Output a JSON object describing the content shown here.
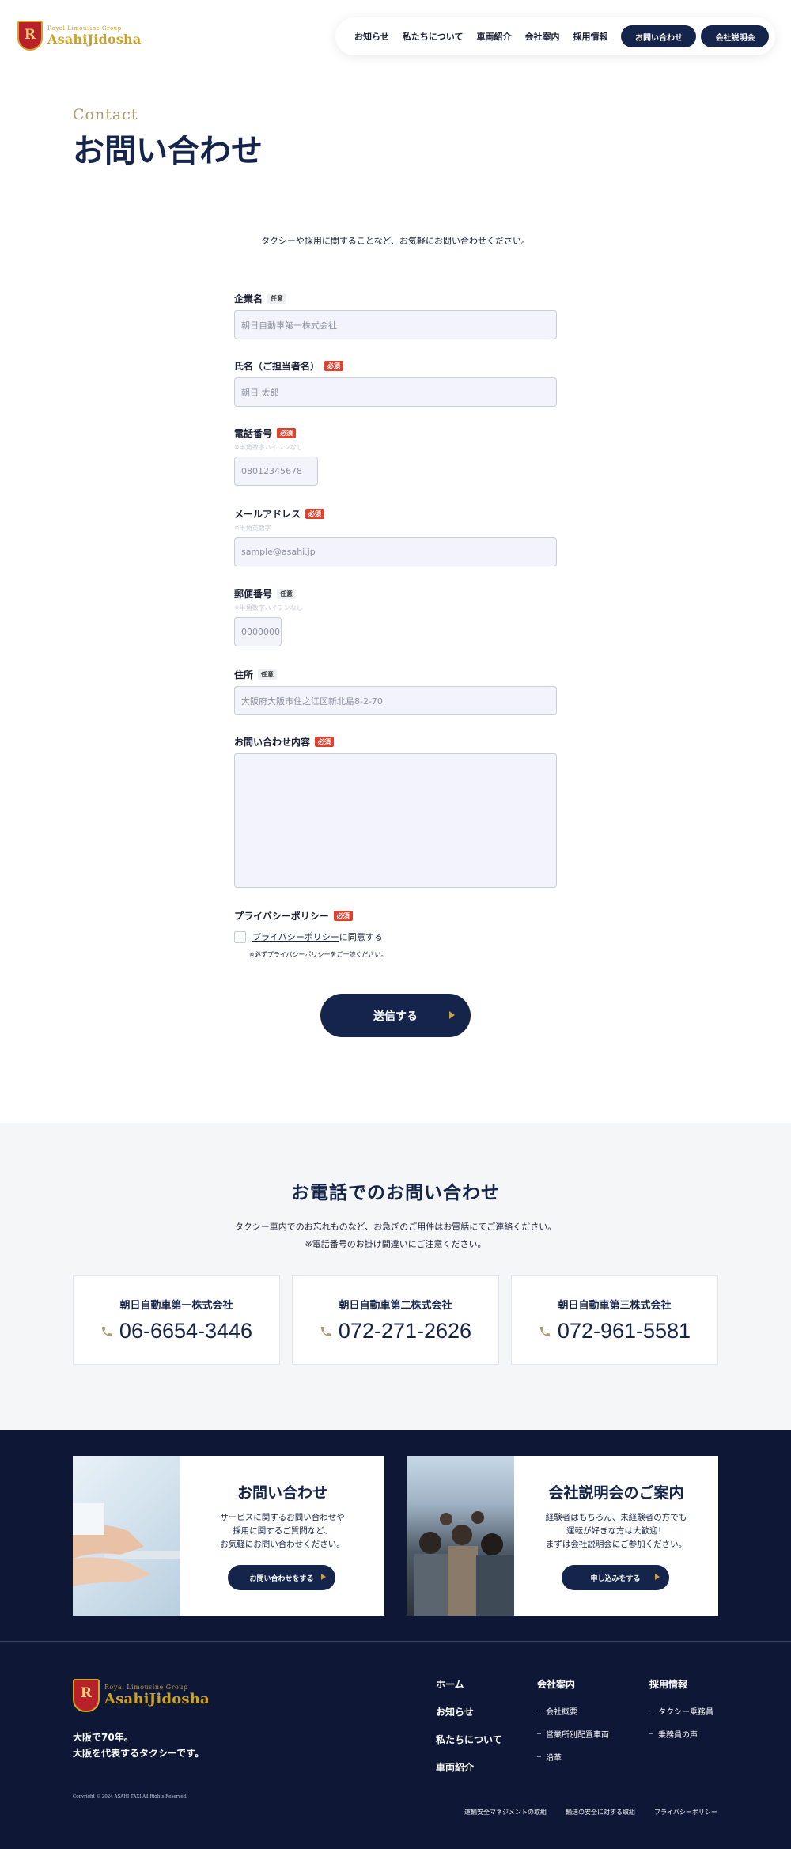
{
  "header": {
    "logo_sub": "Royal Limousine Group",
    "logo_main": "AsahiJidosha",
    "logo_mark": "R",
    "nav": [
      "お知らせ",
      "私たちについて",
      "車両紹介",
      "会社案内",
      "採用情報"
    ],
    "cta_contact": "お問い合わせ",
    "cta_briefing": "会社説明会"
  },
  "contact": {
    "eyebrow": "Contact",
    "title": "お問い合わせ",
    "intro": "タクシーや採用に関することなど、お気軽にお問い合わせください。"
  },
  "badges": {
    "optional": "任意",
    "required": "必須"
  },
  "form": {
    "company": {
      "label": "企業名",
      "placeholder": "朝日自動車第一株式会社"
    },
    "name": {
      "label": "氏名（ご担当者名）",
      "placeholder": "朝日 太郎"
    },
    "phone": {
      "label": "電話番号",
      "note": "※半角数字ハイフンなし",
      "placeholder": "08012345678"
    },
    "email": {
      "label": "メールアドレス",
      "note": "※半角英数字",
      "placeholder": "sample@asahi.jp"
    },
    "postal": {
      "label": "郵便番号",
      "note": "※半角数字ハイフンなし",
      "placeholder": "0000000"
    },
    "address": {
      "label": "住所",
      "placeholder": "大阪府大阪市住之江区新北島8-2-70"
    },
    "inquiry": {
      "label": "お問い合わせ内容",
      "placeholder": ""
    },
    "privacy": {
      "label": "プライバシーポリシー",
      "link": "プライバシーポリシー",
      "agree": "に同意する",
      "note": "※必ずプライバシーポリシーをご一読ください。"
    },
    "submit": "送信する"
  },
  "phone_section": {
    "title": "お電話でのお問い合わせ",
    "desc1": "タクシー車内でのお忘れものなど、お急ぎのご用件はお電話にてご連絡ください。",
    "desc2": "※電話番号のお掛け間違いにご注意ください。",
    "cards": [
      {
        "company": "朝日自動車第一株式会社",
        "number": "06-6654-3446"
      },
      {
        "company": "朝日自動車第二株式会社",
        "number": "072-271-2626"
      },
      {
        "company": "朝日自動車第三株式会社",
        "number": "072-961-5581"
      }
    ]
  },
  "banners": [
    {
      "title": "お問い合わせ",
      "lines": [
        "サービスに関するお問い合わせや",
        "採用に関するご質問など、",
        "お気軽にお問い合わせください。"
      ],
      "button": "お問い合わせをする"
    },
    {
      "title": "会社説明会のご案内",
      "lines": [
        "経験者はもちろん、未経験者の方でも",
        "運転が好きな方は大歓迎！",
        "まずは会社説明会にご参加ください。"
      ],
      "button": "申し込みをする"
    }
  ],
  "footer": {
    "tagline1": "大阪で70年。",
    "tagline2": "大阪を代表するタクシーです。",
    "copyright": "Copyright © 2024 ASAHI TAXI All Rights Reserved.",
    "col1": [
      "ホーム",
      "お知らせ",
      "私たちについて",
      "車両紹介"
    ],
    "col2": {
      "heading": "会社案内",
      "items": [
        "会社概要",
        "営業所別配置車両",
        "沿革"
      ]
    },
    "col3": {
      "heading": "採用情報",
      "items": [
        "タクシー乗務員",
        "乗務員の声"
      ]
    },
    "bottom_links": [
      "運輸安全マネジメントの取組",
      "輸送の安全に対する取組",
      "プライバシーポリシー"
    ]
  },
  "colors": {
    "navy": "#15244a",
    "dark_bg": "#0e1836",
    "gold": "#c9a227",
    "required": "#d9432f",
    "light_bg": "#f5f6f8"
  }
}
